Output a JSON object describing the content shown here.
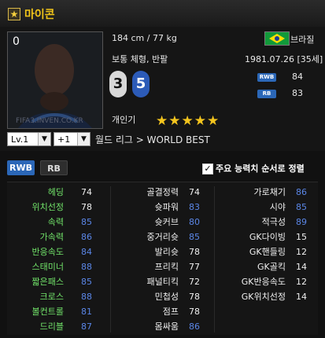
{
  "header": {
    "title": "마이콘"
  },
  "player": {
    "number": "0",
    "watermark": "FIFA3.INVEN.CO.KR",
    "height_weight": "184 cm / 77 kg",
    "body_type": "보통 체형, 반팔",
    "nationality": "브라질",
    "birth": "1981.07.26 [35세]",
    "left_foot": "3",
    "right_foot": "5",
    "positions": [
      {
        "label": "RWB",
        "value": "84"
      },
      {
        "label": "RB",
        "value": "83"
      }
    ],
    "popularity_label": "개인기",
    "popularity_stars": 5,
    "league": "월드 리그 > WORLD BEST"
  },
  "controls": {
    "level": "Lv.1",
    "plus": "+1"
  },
  "tabs": [
    {
      "label": "RWB",
      "active": true
    },
    {
      "label": "RB",
      "active": false
    }
  ],
  "sort_option": {
    "checked": true,
    "label": "주요 능력치 순서로 정렬"
  },
  "stats": {
    "col1": [
      {
        "label": "헤딩",
        "value": "74",
        "tone": "white"
      },
      {
        "label": "위치선정",
        "value": "78",
        "tone": "white"
      },
      {
        "label": "속력",
        "value": "85",
        "tone": "blue"
      },
      {
        "label": "가속력",
        "value": "86",
        "tone": "blue"
      },
      {
        "label": "반응속도",
        "value": "84",
        "tone": "blue"
      },
      {
        "label": "스태미너",
        "value": "88",
        "tone": "blue"
      },
      {
        "label": "짧은패스",
        "value": "85",
        "tone": "blue"
      },
      {
        "label": "크로스",
        "value": "88",
        "tone": "blue"
      },
      {
        "label": "볼컨트롤",
        "value": "81",
        "tone": "blue"
      },
      {
        "label": "드리블",
        "value": "87",
        "tone": "blue"
      }
    ],
    "col2": [
      {
        "label": "골결정력",
        "value": "74",
        "tone": "white"
      },
      {
        "label": "슛파워",
        "value": "83",
        "tone": "blue"
      },
      {
        "label": "슛커브",
        "value": "80",
        "tone": "blue"
      },
      {
        "label": "중거리슛",
        "value": "85",
        "tone": "blue"
      },
      {
        "label": "발리슛",
        "value": "78",
        "tone": "white"
      },
      {
        "label": "프리킥",
        "value": "77",
        "tone": "white"
      },
      {
        "label": "패널티킥",
        "value": "72",
        "tone": "white"
      },
      {
        "label": "민첩성",
        "value": "78",
        "tone": "white"
      },
      {
        "label": "점프",
        "value": "78",
        "tone": "white"
      },
      {
        "label": "몸싸움",
        "value": "86",
        "tone": "blue"
      }
    ],
    "col3": [
      {
        "label": "가로채기",
        "value": "86",
        "tone": "blue"
      },
      {
        "label": "시야",
        "value": "85",
        "tone": "blue"
      },
      {
        "label": "적극성",
        "value": "89",
        "tone": "blue"
      },
      {
        "label": "GK다이빙",
        "value": "15",
        "tone": "white"
      },
      {
        "label": "GK핸들링",
        "value": "12",
        "tone": "white"
      },
      {
        "label": "GK골킥",
        "value": "14",
        "tone": "white"
      },
      {
        "label": "GK반응속도",
        "value": "12",
        "tone": "white"
      },
      {
        "label": "GK위치선정",
        "value": "14",
        "tone": "white"
      }
    ]
  },
  "colors": {
    "accent": "#f0c419",
    "blue": "#2b67b7",
    "green": "#72e56a"
  }
}
